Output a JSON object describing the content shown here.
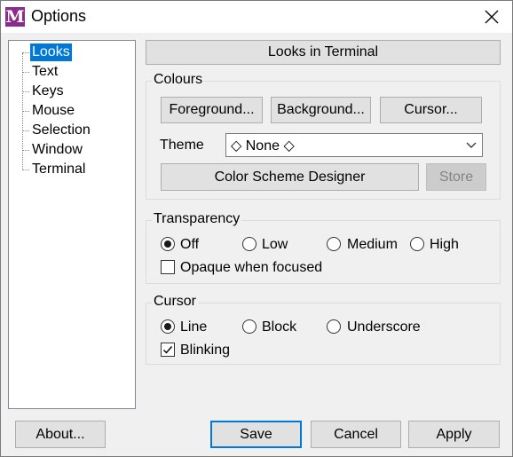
{
  "window": {
    "title": "Options"
  },
  "tree": {
    "items": [
      {
        "label": "Looks",
        "selected": true
      },
      {
        "label": "Text"
      },
      {
        "label": "Keys"
      },
      {
        "label": "Mouse"
      },
      {
        "label": "Selection"
      },
      {
        "label": "Window"
      },
      {
        "label": "Terminal"
      }
    ]
  },
  "panel": {
    "header": "Looks in Terminal",
    "colours": {
      "label": "Colours",
      "foreground_btn": "Foreground...",
      "background_btn": "Background...",
      "cursor_btn": "Cursor...",
      "theme_label": "Theme",
      "theme_value": "◇ None ◇",
      "designer_btn": "Color Scheme Designer",
      "store_btn": "Store"
    },
    "transparency": {
      "label": "Transparency",
      "options": [
        "Off",
        "Low",
        "Medium",
        "High"
      ],
      "selected": "Off",
      "opaque_label": "Opaque when focused",
      "opaque_checked": false
    },
    "cursor": {
      "label": "Cursor",
      "options": [
        "Line",
        "Block",
        "Underscore"
      ],
      "selected": "Line",
      "blinking_label": "Blinking",
      "blinking_checked": true
    }
  },
  "footer": {
    "about": "About...",
    "save": "Save",
    "cancel": "Cancel",
    "apply": "Apply"
  },
  "colors": {
    "accent": "#0078d7",
    "app_icon": "#8a2c8c"
  }
}
